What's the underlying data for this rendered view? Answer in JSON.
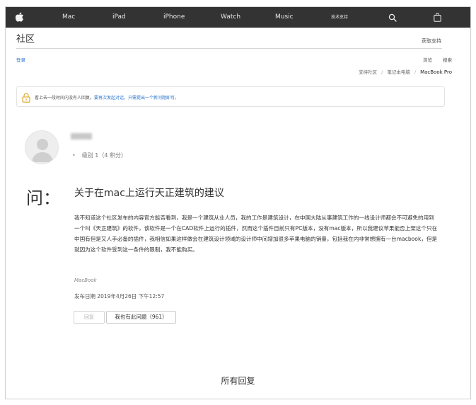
{
  "nav": {
    "items": [
      "Mac",
      "iPad",
      "iPhone",
      "Watch",
      "Music",
      "技术支持"
    ],
    "icons": [
      "apple-logo-icon",
      "search-icon",
      "shopping-bag-icon"
    ],
    "bg_color": "#333333"
  },
  "header": {
    "title": "社区",
    "get_support": "获取支持",
    "login": "登录",
    "browse": "浏览",
    "search": "搜索"
  },
  "breadcrumb": {
    "items": [
      "支持社区",
      "笔记本电脑",
      "MacBook Pro"
    ]
  },
  "notice": {
    "text": "看上去一段时间内没有人回复。",
    "link": "要再次发起对话，只需提出一个新问题即可。",
    "icon": "lock-icon"
  },
  "author": {
    "level": "级别 1（4 积分）"
  },
  "question": {
    "mark": "问：",
    "title": "关于在mac上运行天正建筑的建议",
    "body": "我不知道这个社区发布的内容官方能否看到，我是一个建筑从业人员，我的工作是建筑设计，在中国大陆从事建筑工作的一线设计师都会不可避免的用到一个叫《天正建筑》的软件，该软件是一个在CAD软件上运行的插件，然而这个插件目前只有PC版本，没有mac版本，所以我建议苹果能否上架这个只在中国有但是又人手必备的插件，我相信如果这样做会在建筑设计领域的设计师中间增加很多苹果电脑的销量，包括我在内非常想拥有一台macbook，但是就因为这个软件受到这一条件的限制，我不能购买。",
    "tag": "MacBook",
    "date": "发布日期 2019年4月26日 下午12:57"
  },
  "actions": {
    "reply": "回复",
    "same_question": "我也有此问题（961）"
  },
  "replies": {
    "title": "所有回复"
  },
  "colors": {
    "link": "#2a73c9",
    "notice_icon": "#d9a323"
  }
}
